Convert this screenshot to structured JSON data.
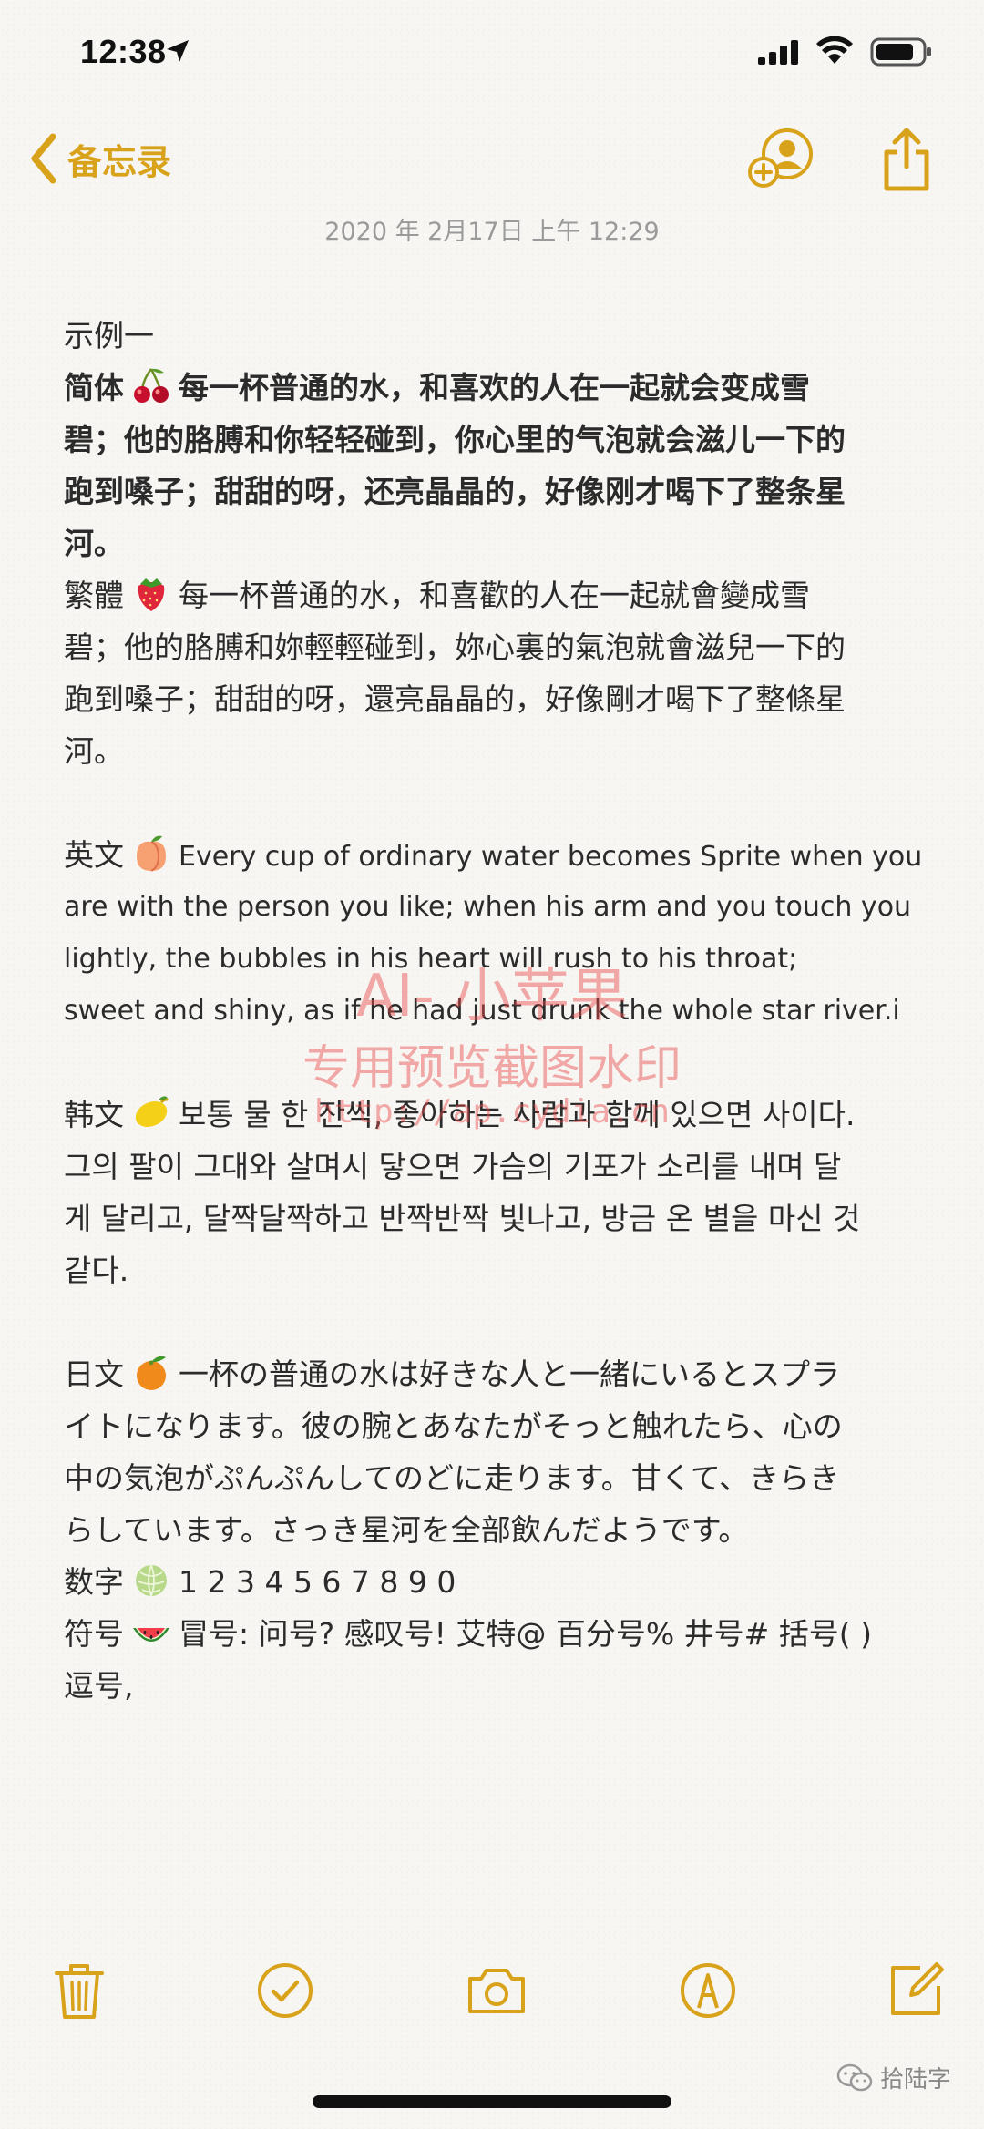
{
  "status_bar": {
    "time": "12:38",
    "icons": [
      "location-arrow-icon",
      "cellular-signal-icon",
      "wifi-icon",
      "battery-icon"
    ]
  },
  "nav": {
    "back_label": "备忘录",
    "collab_icon": "add-person-icon",
    "share_icon": "share-icon"
  },
  "note": {
    "date": "2020 年 2月17日 上午 12:29",
    "heading": "示例一",
    "simplified": {
      "label": "简体",
      "emoji": "cherries-emoji",
      "lines": [
        "每一杯普通的水，和喜欢的人在一起就会变成雪",
        "碧；他的胳膊和你轻轻碰到，你心里的气泡就会滋儿一下的",
        "跑到嗓子；甜甜的呀，还亮晶晶的，好像刚才喝下了整条星",
        "河。"
      ]
    },
    "traditional": {
      "label": "繁體",
      "emoji": "strawberry-emoji",
      "lines": [
        "每一杯普通的水，和喜歡的人在一起就會變成雪",
        "碧；他的胳膊和妳輕輕碰到，妳心裏的氣泡就會滋兒一下的",
        "跑到嗓子；甜甜的呀，還亮晶晶的，好像剛才喝下了整條星",
        "河。"
      ]
    },
    "english": {
      "label": "英文",
      "emoji": "peach-emoji",
      "lines": [
        "Every cup of ordinary water becomes Sprite when you",
        "are with the person you like; when his arm and you touch you",
        "lightly, the bubbles in his heart will rush to his throat;",
        "sweet and shiny, as if he had just drunk the whole star river.i"
      ]
    },
    "korean": {
      "label": "韩文",
      "emoji": "lemon-emoji",
      "lines": [
        "보통 물 한 잔씩, 좋아하는 사람과 함께 있으면 사이다.",
        "그의 팔이 그대와 살며시 닿으면 가슴의 기포가 소리를 내며 달",
        "게 달리고, 달짝달짝하고 반짝반짝 빛나고, 방금 온 별을 마신 것",
        "같다."
      ]
    },
    "japanese": {
      "label": "日文",
      "emoji": "tangerine-emoji",
      "lines": [
        "一杯の普通の水は好きな人と一緒にいるとスプラ",
        "イトになります。彼の腕とあなたがそっと触れたら、心の",
        "中の気泡がぷんぷんしてのどに走ります。甘くて、きらき",
        "らしています。さっき星河を全部飲んだようです。"
      ]
    },
    "numbers": {
      "label": "数字",
      "emoji": "melon-emoji",
      "text": "1 2 3 4 5 6 7 8 9 0"
    },
    "symbols": {
      "label": "符号",
      "emoji": "watermelon-emoji",
      "text": "冒号: 问号? 感叹号! 艾特@ 百分号% 井号# 括号( )",
      "line2": "逗号,"
    }
  },
  "watermark": {
    "title": "AI- 小苹果",
    "subtitle": "专用预览截图水印",
    "url": "http://ap.cydia.cn"
  },
  "toolbar": {
    "items": [
      "trash-icon",
      "checklist-icon",
      "camera-icon",
      "markup-icon",
      "compose-icon"
    ]
  },
  "footer": {
    "wechat_label": "拾陆字"
  },
  "colors": {
    "accent": "#d9a21b",
    "background": "#f7f6f3",
    "text": "#2b2b2b",
    "date": "#9a9a9a",
    "watermark": "#e64646"
  }
}
